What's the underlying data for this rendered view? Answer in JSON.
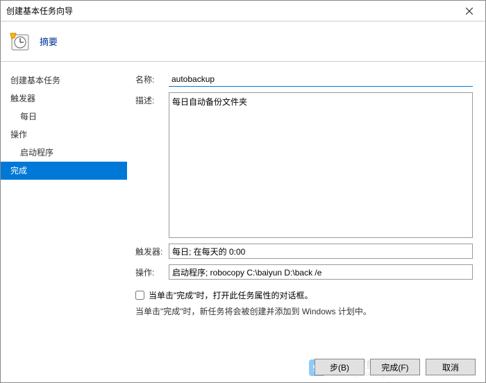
{
  "window": {
    "title": "创建基本任务向导"
  },
  "header": {
    "title": "摘要"
  },
  "sidebar": {
    "items": [
      {
        "label": "创建基本任务",
        "indent": false
      },
      {
        "label": "触发器",
        "indent": false
      },
      {
        "label": "每日",
        "indent": true
      },
      {
        "label": "操作",
        "indent": false
      },
      {
        "label": "启动程序",
        "indent": true
      },
      {
        "label": "完成",
        "indent": false,
        "selected": true
      }
    ]
  },
  "form": {
    "name_label": "名称:",
    "name_value": "autobackup",
    "desc_label": "描述:",
    "desc_value": "每日自动备份文件夹",
    "trigger_label": "触发器:",
    "trigger_value": "每日; 在每天的 0:00",
    "action_label": "操作:",
    "action_value": "启动程序; robocopy C:\\baiyun D:\\back /e",
    "open_props_label": "当单击\"完成\"时，打开此任务属性的对话框。",
    "info_text": "当单击\"完成\"时，新任务将会被创建并添加到 Windows 计划中。"
  },
  "footer": {
    "back": "步(B)",
    "finish": "完成(F)",
    "cancel": "取消"
  },
  "watermark": {
    "brand": "白云一键重装系统",
    "url": "www.baiyunxitong.com"
  }
}
